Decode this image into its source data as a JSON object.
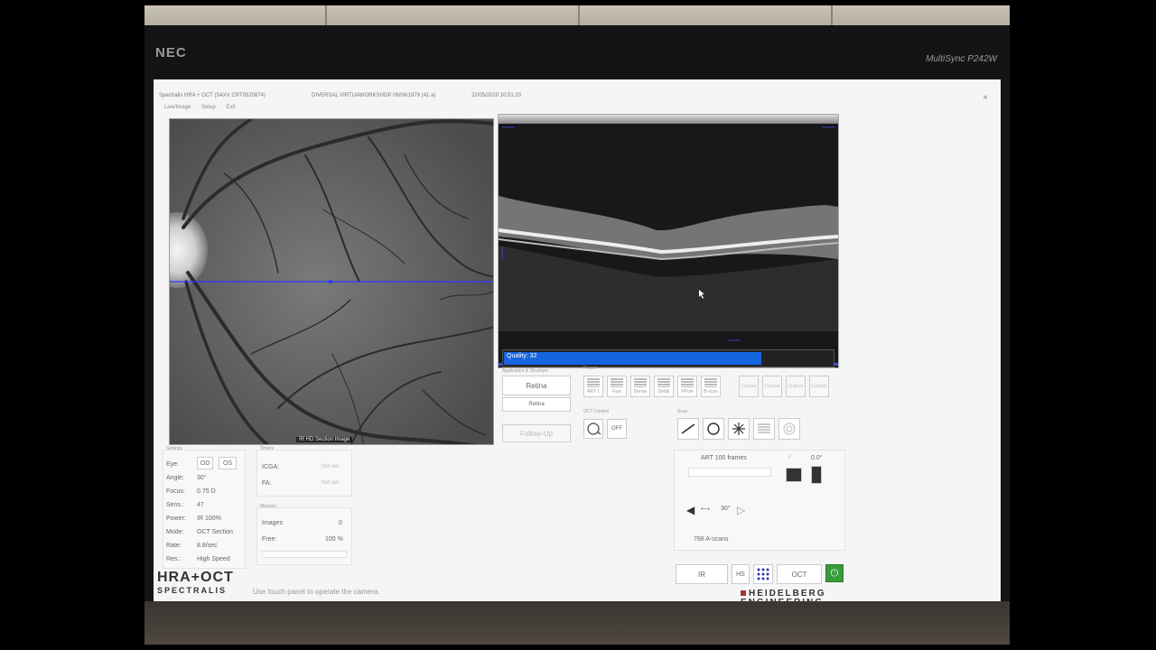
{
  "monitor": {
    "brand": "NEC",
    "model": "MultiSync P242W"
  },
  "window": {
    "title": "Spectralis HRA + OCT (S4XX CRT0520874)",
    "patient": "DIVERSAL VIRTUAWORKSHOP  06/06/1979 (41 a)",
    "datetime": "22/05/2020 10:51:20",
    "close": "×",
    "menu": [
      "Live/Image",
      "Setup",
      "Exit"
    ]
  },
  "fundus": {
    "caption": "IR HD Section Image"
  },
  "oct": {
    "quality_label": "Quality: 32",
    "quality_value": 32,
    "quality_percent": 78
  },
  "acquisition": {
    "group_label": "Application & Structure",
    "retina_button": "Retina",
    "retina_sub": "Retina",
    "followup_button": "Follow-Up"
  },
  "preset": {
    "group_label": "Preset",
    "items": [
      "ART 1",
      "Fast",
      "Dense",
      "Detail",
      "PPole",
      "B-scan"
    ],
    "custom": [
      "Custom",
      "Custom",
      "Custom",
      "Custom"
    ]
  },
  "oct_control": {
    "group_label": "OCT Control",
    "off_label": "OFF"
  },
  "scan": {
    "group_label": "Scan"
  },
  "settings": {
    "group_label": "Settings",
    "eye_label": "Eye:",
    "eye_od": "OD",
    "eye_os": "OS",
    "angle_label": "Angle:",
    "angle": "30°",
    "focus_label": "Focus:",
    "focus": "0.75 D",
    "sens_label": "Sens.:",
    "sens": "47",
    "power_label": "Power:",
    "power": "IR  100%",
    "mode_label": "Mode:",
    "mode": "OCT Section",
    "rate_label": "Rate:",
    "rate": "8.8/sec",
    "res_label": "Res.:",
    "res": "High Speed"
  },
  "timers": {
    "group_label": "Timers",
    "icga_label": "ICGA:",
    "icga_value": "Not set",
    "fa_label": "FA:",
    "fa_value": "Not set"
  },
  "memory": {
    "group_label": "Memory",
    "images_label": "Images",
    "images_value": "0",
    "free_label": "Free:",
    "free_value": "100 %"
  },
  "art": {
    "label": "ART 100 frames",
    "tilt": "0.0°",
    "angle": "30°",
    "ascans": "768 A-scans"
  },
  "bottom": {
    "ir": "IR",
    "hs": "HS",
    "oct": "OCT",
    "power_icon": "⏻"
  },
  "footer": {
    "message": "Use touch panel to operate the camera.",
    "logo_line1": "HRA+OCT",
    "logo_line2": "SPECTRALIS",
    "company_line1": "HEIDELBERG",
    "company_line2": "ENGINEERING"
  },
  "colors": {
    "accent": "#1565e0",
    "power": "#3a9a3a",
    "brand_red": "#a33333"
  }
}
